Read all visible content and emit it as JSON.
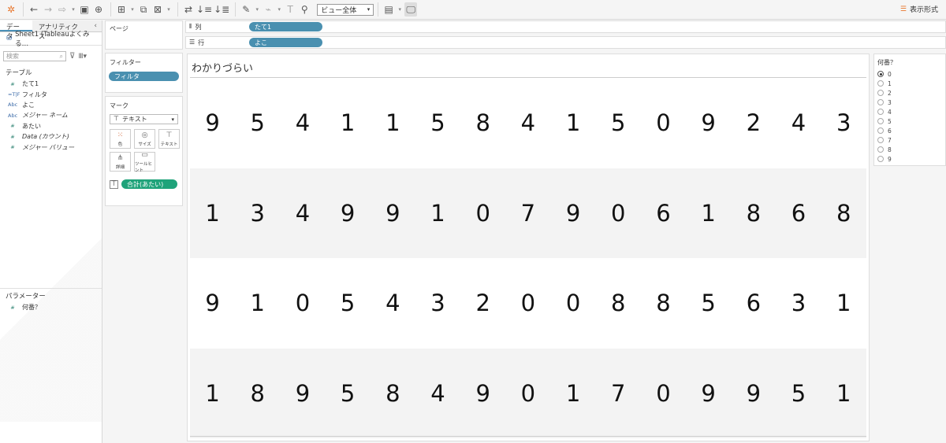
{
  "toolbar": {
    "view_select": "ビュー全体",
    "show_me": "表示形式"
  },
  "left": {
    "tab_data": "データ",
    "tab_analytics": "アナリティクス",
    "datasource": "Sheet1 (Tableauよくみる…",
    "search_placeholder": "検索",
    "tables_header": "テーブル",
    "fields": [
      {
        "icon": "#",
        "label": "たて1",
        "italic": false
      },
      {
        "icon": "=T|F",
        "label": "フィルタ",
        "italic": false
      },
      {
        "icon": "Abc",
        "label": "よこ",
        "italic": false
      },
      {
        "icon": "Abc",
        "label": "メジャー ネーム",
        "italic": true
      },
      {
        "icon": "#",
        "label": "あたい",
        "italic": false
      },
      {
        "icon": "#",
        "label": "Data (カウント)",
        "italic": true
      },
      {
        "icon": "#",
        "label": "メジャー バリュー",
        "italic": true
      }
    ],
    "params_header": "パラメーター",
    "param_item": "何番？"
  },
  "cards": {
    "pages_title": "ページ",
    "filters_title": "フィルター",
    "filter_pill": "フィルタ",
    "marks_title": "マーク",
    "mark_type": "テキスト",
    "mark_buttons": [
      "色",
      "サイズ",
      "テキスト",
      "詳細",
      "ツールヒント"
    ],
    "text_pill": "合計(あたい)"
  },
  "shelves": {
    "columns_label": "列",
    "columns_pill": "たて1",
    "rows_label": "行",
    "rows_pill": "よこ"
  },
  "view": {
    "title": "わかりづらい",
    "rows": [
      [
        9,
        5,
        4,
        1,
        1,
        5,
        8,
        4,
        1,
        5,
        0,
        9,
        2,
        4,
        3
      ],
      [
        1,
        3,
        4,
        9,
        9,
        1,
        0,
        7,
        9,
        0,
        6,
        1,
        8,
        6,
        8
      ],
      [
        9,
        1,
        0,
        5,
        4,
        3,
        2,
        0,
        0,
        8,
        8,
        5,
        6,
        3,
        1
      ],
      [
        1,
        8,
        9,
        5,
        8,
        4,
        9,
        0,
        1,
        7,
        0,
        9,
        9,
        5,
        1
      ]
    ]
  },
  "param_card": {
    "title": "何番？",
    "options": [
      "0",
      "1",
      "2",
      "3",
      "4",
      "5",
      "6",
      "7",
      "8",
      "9"
    ],
    "selected": "0"
  }
}
